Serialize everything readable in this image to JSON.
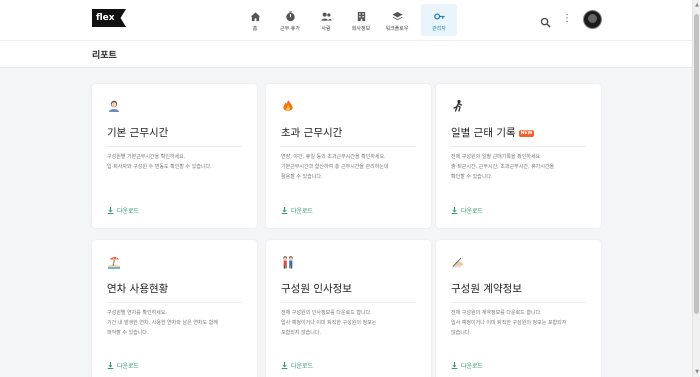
{
  "header": {
    "logo": "flex",
    "nav": [
      {
        "label": "홈",
        "icon": "home-icon"
      },
      {
        "label": "근무·휴가",
        "icon": "clock-icon"
      },
      {
        "label": "사람",
        "icon": "people-icon"
      },
      {
        "label": "회사정보",
        "icon": "building-icon"
      },
      {
        "label": "워크플로우",
        "icon": "stack-icon"
      },
      {
        "label": "관리자",
        "icon": "key-icon",
        "active": true
      }
    ]
  },
  "page": {
    "title": "리포트"
  },
  "cards": [
    {
      "title": "기본 근무시간",
      "icon": "person-emoji-icon",
      "desc": "구성원별 기본근무시간을 확인하세요.\n입·퇴사자와 구성원 수 변동도 확인할 수 있습니다.",
      "download": "다운로드"
    },
    {
      "title": "초과 근무시간",
      "icon": "fire-emoji-icon",
      "desc": "연장, 야간, 휴일 등의 초과근무시간을 확인하세요.\n기본근무시간과 합산하여 총 근무시간을 관리하는데\n활용할 수 있습니다.",
      "download": "다운로드"
    },
    {
      "title": "일별 근태 기록",
      "badge": "NEW",
      "icon": "runner-emoji-icon",
      "desc": "전체 구성원의 일별 근태기록을 확인하세요.\n출·퇴근시간, 근무시간, 초과근무시간, 휴가시간을\n확인할 수 있습니다.",
      "download": "다운로드"
    },
    {
      "title": "연차 사용현황",
      "icon": "beach-emoji-icon",
      "desc": "구성원별 연차를 확인하세요.\n기간 내 발생한 연차, 사용한 연차와 남은 연차도 함께\n파악할 수 있습니다.",
      "download": "다운로드"
    },
    {
      "title": "구성원 인사정보",
      "icon": "people-emoji-icon",
      "desc": "전체 구성원의 인사정보를 다운로드 합니다.\n입사 예정이거나 이미 퇴직한 구성원의 정보는\n포함되지 않습니다.",
      "download": "다운로드"
    },
    {
      "title": "구성원 계약정보",
      "icon": "writing-hand-emoji-icon",
      "desc": "전체 구성원의 계약정보를 다운로드 합니다.\n입사 예정이거나 이미 퇴직한 구성원의 정보는 포함되지\n않습니다.",
      "download": "다운로드"
    }
  ],
  "colors": {
    "accent": "#2e9a6b",
    "active_nav": "#1a83c9",
    "badge": "#f4612b"
  }
}
